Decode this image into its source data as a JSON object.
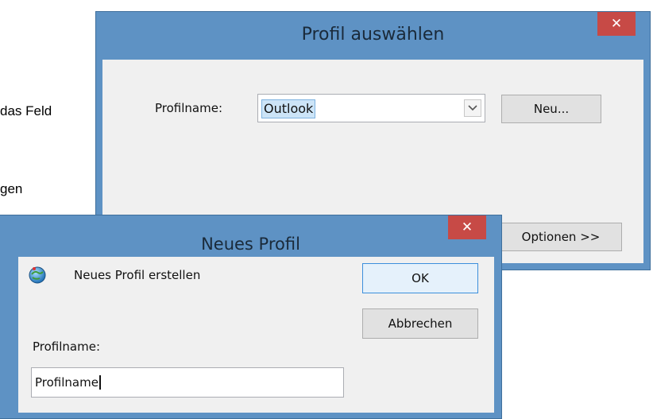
{
  "background": {
    "line1": "das Feld",
    "line2": "gen"
  },
  "profile_dialog": {
    "title": "Profil auswählen",
    "close_glyph": "✕",
    "profile_label": "Profilname:",
    "profile_value": "Outlook",
    "dropdown_glyph": "⌄",
    "new_button": "Neu...",
    "options_button": "Optionen >>"
  },
  "new_profile_dialog": {
    "title": "Neues Profil",
    "close_glyph": "✕",
    "icon": "outlook-profile-icon",
    "create_text": "Neues Profil erstellen",
    "ok_button": "OK",
    "cancel_button": "Abbrechen",
    "profile_label": "Profilname:",
    "profile_value": "Profilname"
  },
  "colors": {
    "window_frame": "#5e92c4",
    "close_button": "#c74a46",
    "client": "#f0f0f0",
    "selection": "#cce4f7"
  }
}
